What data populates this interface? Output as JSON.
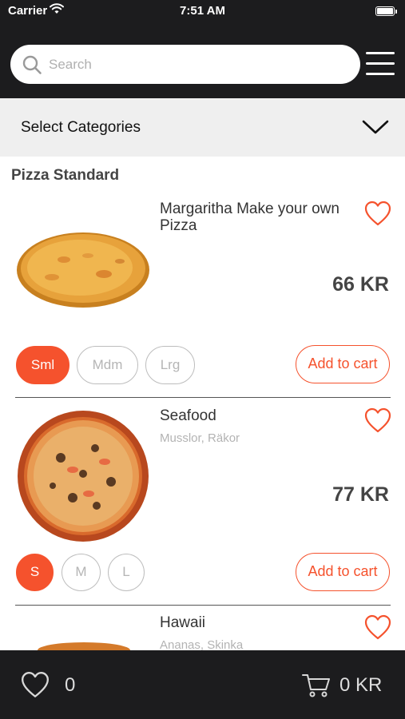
{
  "status_bar": {
    "carrier": "Carrier",
    "time": "7:51 AM"
  },
  "header": {
    "search_placeholder": "Search",
    "search_value": ""
  },
  "categories": {
    "label": "Select Categories"
  },
  "section": {
    "title": "Pizza Standard"
  },
  "products": [
    {
      "name": "Margaritha Make your own Pizza",
      "description": "",
      "price": "66 KR",
      "sizes": [
        "Sml",
        "Mdm",
        "Lrg"
      ],
      "selected_size": "Sml",
      "add_label": "Add to cart"
    },
    {
      "name": "Seafood",
      "description": "Musslor, Räkor",
      "price": "77 KR",
      "sizes": [
        "S",
        "M",
        "L"
      ],
      "selected_size": "S",
      "add_label": "Add to cart"
    },
    {
      "name": "Hawaii",
      "description": "Ananas, Skinka"
    }
  ],
  "bottom_bar": {
    "favorites_count": "0",
    "cart_total": "0 KR"
  },
  "colors": {
    "accent": "#f5522d",
    "dark": "#1c1c1e",
    "category_bg": "#efefef"
  },
  "icons": [
    "wifi-icon",
    "battery-icon",
    "search-icon",
    "hamburger-menu-icon",
    "chevron-down-icon",
    "heart-icon",
    "cart-icon"
  ]
}
